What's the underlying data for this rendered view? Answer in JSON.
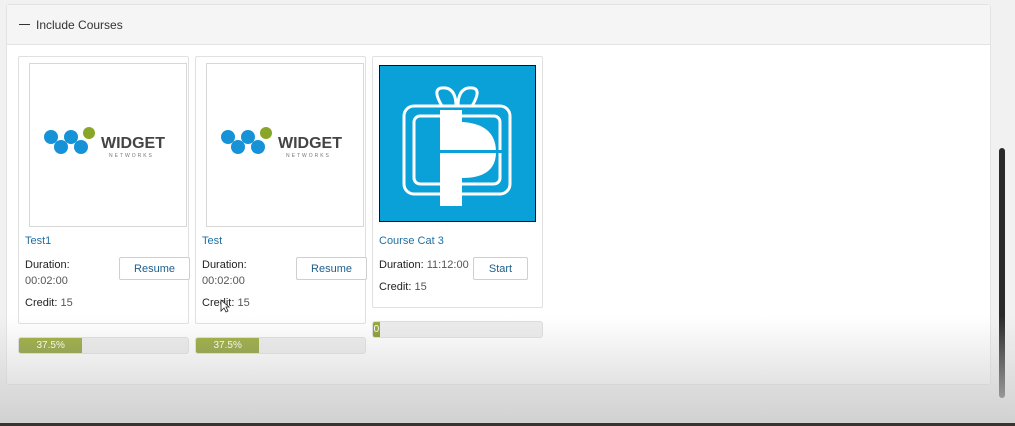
{
  "section": {
    "title": "Include Courses"
  },
  "courses": [
    {
      "title": "Test1",
      "logo_text": "WIDGET",
      "logo_sub": "NETWORKS",
      "duration_label": "Duration:",
      "duration": "00:02:00",
      "credit_label": "Credit:",
      "credit": "15",
      "button": "Resume",
      "progress_pct": 37.5,
      "progress_label": "37.5%"
    },
    {
      "title": "Test",
      "logo_text": "WIDGET",
      "logo_sub": "NETWORKS",
      "duration_label": "Duration:",
      "duration": "00:02:00",
      "credit_label": "Credit:",
      "credit": "15",
      "button": "Resume",
      "progress_pct": 37.5,
      "progress_label": "37.5%"
    },
    {
      "title": "Course Cat 3",
      "duration_label": "Duration:",
      "duration": "11:12:00",
      "credit_label": "Credit:",
      "credit": "15",
      "button": "Start",
      "progress_pct": 0,
      "progress_label": "0"
    }
  ],
  "colors": {
    "link": "#1d6fa5",
    "progress": "#8a9c28",
    "gift_bg": "#0aa0d8"
  }
}
